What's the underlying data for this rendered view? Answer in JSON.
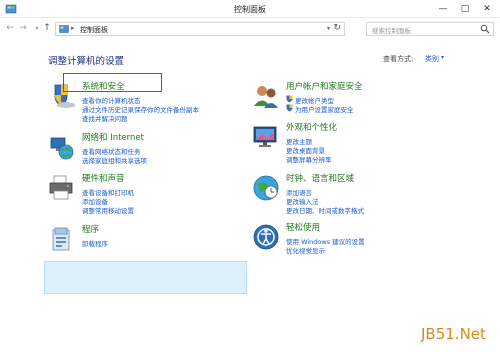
{
  "window": {
    "title": "控制面板",
    "minimize": "—",
    "maximize": "□",
    "close": "✕"
  },
  "nav": {
    "back": "←",
    "forward": "→",
    "history": "▾",
    "up": "↑",
    "address_sep": "▸",
    "address": "控制面板",
    "address_drop": "▾",
    "refresh": "↻",
    "search_placeholder": "搜索控制面板"
  },
  "main": {
    "heading": "调整计算机的设置",
    "view_by_label": "查看方式:",
    "view_by_value": "类别",
    "view_arrow": "▾"
  },
  "categories": [
    {
      "title": "系统和安全",
      "icon": "shield-flag-icon",
      "links": [
        "查看你的计算机状态",
        "通过文件历史记录保存你的文件备份副本",
        "查找并解决问题"
      ]
    },
    {
      "title": "网络和 Internet",
      "icon": "network-globe-icon",
      "links": [
        "查看网络状态和任务",
        "选择家庭组和共享选项"
      ]
    },
    {
      "title": "硬件和声音",
      "icon": "printer-icon",
      "links": [
        "查看设备和打印机",
        "添加设备",
        "调整常用移动设置"
      ]
    },
    {
      "title": "程序",
      "icon": "programs-icon",
      "links": [
        "卸载程序"
      ]
    },
    {
      "title": "用户帐户和家庭安全",
      "icon": "users-icon",
      "links": [
        "更改帐户类型",
        "为用户设置家庭安全"
      ]
    },
    {
      "title": "外观和个性化",
      "icon": "monitor-icon",
      "links": [
        "更改主题",
        "更改桌面背景",
        "调整屏幕分辨率"
      ]
    },
    {
      "title": "时钟、语言和区域",
      "icon": "clock-globe-icon",
      "links": [
        "添加语言",
        "更改输入法",
        "更改日期、时间或数字格式"
      ]
    },
    {
      "title": "轻松使用",
      "icon": "ease-of-access-icon",
      "links": [
        "使用 Windows 建议的设置",
        "优化视觉显示"
      ]
    }
  ],
  "watermark": "JB51.Net",
  "colors": {
    "category_title": "#1f7a1f",
    "link": "#1a5ad6",
    "heading": "#1e3287",
    "highlight": "#d42a2a",
    "selected_bg": "#dcf0fb"
  }
}
